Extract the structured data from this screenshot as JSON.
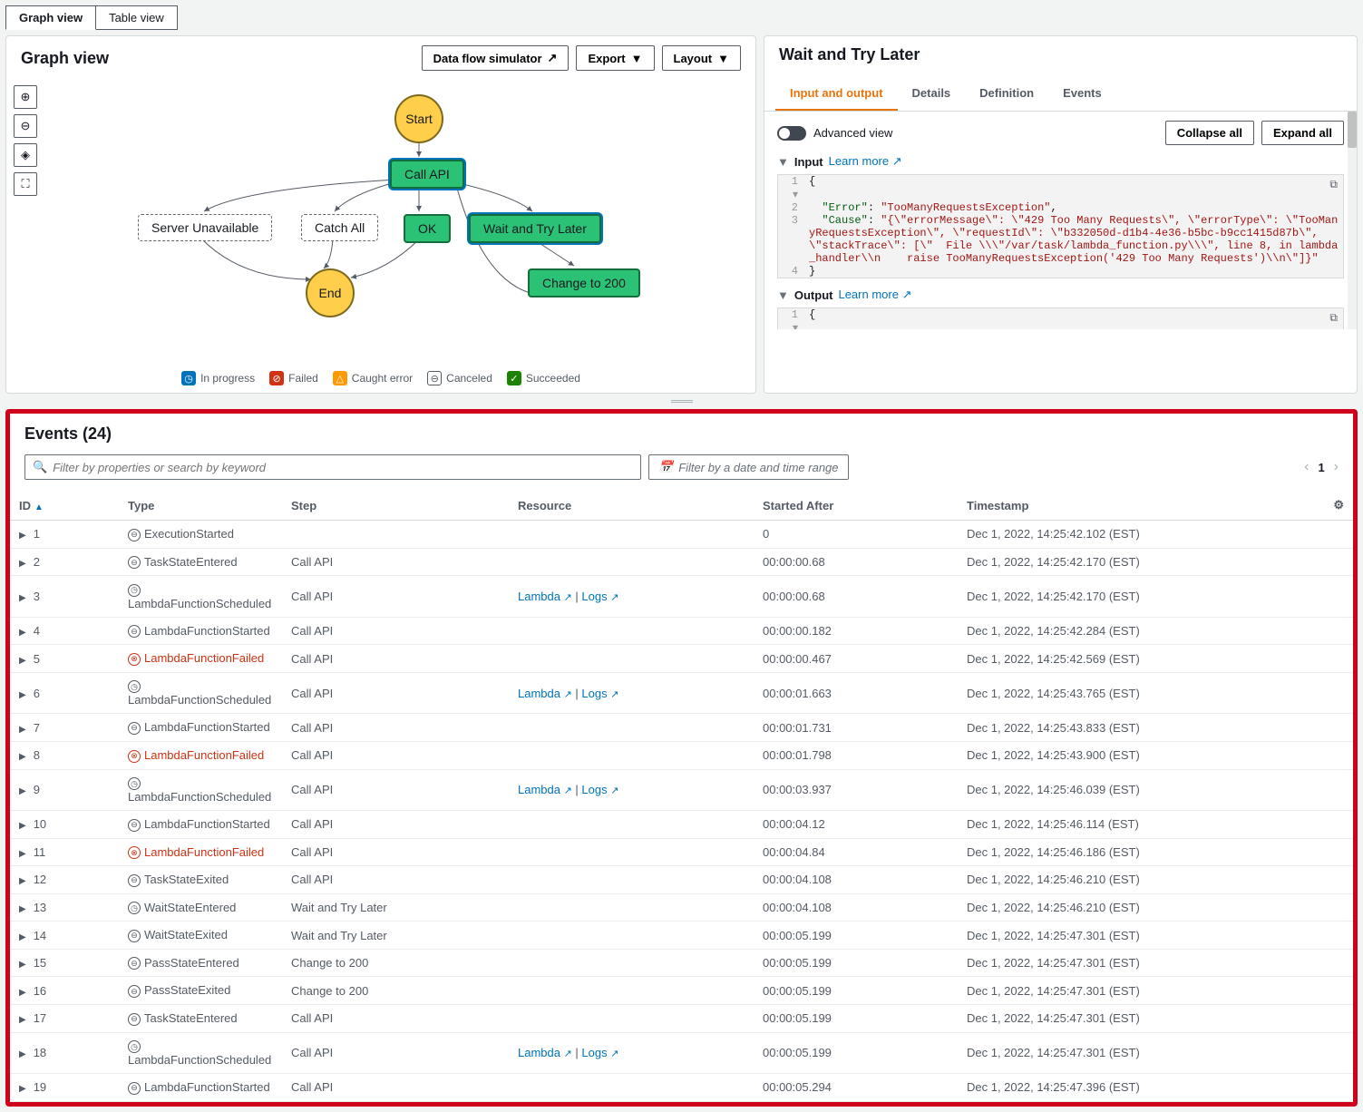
{
  "viewTabs": {
    "graph": "Graph view",
    "table": "Table view"
  },
  "graphPanel": {
    "title": "Graph view",
    "buttons": {
      "simulator": "Data flow simulator",
      "export": "Export",
      "layout": "Layout"
    },
    "nodes": {
      "start": "Start",
      "callApi": "Call API",
      "serverUnavailable": "Server Unavailable",
      "catchAll": "Catch All",
      "ok": "OK",
      "waitTry": "Wait and Try Later",
      "changeTo200": "Change to 200",
      "end": "End"
    },
    "legend": {
      "inProgress": "In progress",
      "failed": "Failed",
      "caughtError": "Caught error",
      "canceled": "Canceled",
      "succeeded": "Succeeded"
    }
  },
  "detailPanel": {
    "title": "Wait and Try Later",
    "tabs": {
      "io": "Input and output",
      "details": "Details",
      "definition": "Definition",
      "events": "Events"
    },
    "advancedView": "Advanced view",
    "collapseAll": "Collapse all",
    "expandAll": "Expand all",
    "inputLabel": "Input",
    "outputLabel": "Output",
    "learnMore": "Learn more",
    "inputJson": {
      "line1": "{",
      "line2_key": "\"Error\"",
      "line2_val": "\"TooManyRequestsException\"",
      "line3_key": "\"Cause\"",
      "line3_val": "\"{\\\"errorMessage\\\": \\\"429 Too Many Requests\\\", \\\"errorType\\\": \\\"TooManyRequestsException\\\", \\\"requestId\\\": \\\"b332050d-d1b4-4e36-b5bc-b9cc1415d87b\\\", \\\"stackTrace\\\": [\\\"  File \\\\\\\"/var/task/lambda_function.py\\\\\\\", line 8, in lambda_handler\\\\n    raise TooManyRequestsException('429 Too Many Requests')\\\\n\\\"]}\"",
      "line4": "}"
    },
    "outputJson": {
      "line1": "{"
    }
  },
  "eventsPanel": {
    "title": "Events (24)",
    "searchPlaceholder": "Filter by properties or search by keyword",
    "datePlaceholder": "Filter by a date and time range",
    "page": "1",
    "columns": {
      "id": "ID",
      "type": "Type",
      "step": "Step",
      "resource": "Resource",
      "startedAfter": "Started After",
      "timestamp": "Timestamp"
    },
    "resourceLambda": "Lambda",
    "resourceLogs": "Logs",
    "rows": [
      {
        "id": "1",
        "icon": "neutral",
        "type": "ExecutionStarted",
        "step": "",
        "resource": "",
        "startedAfter": "0",
        "timestamp": "Dec 1, 2022, 14:25:42.102 (EST)"
      },
      {
        "id": "2",
        "icon": "neutral",
        "type": "TaskStateEntered",
        "step": "Call API",
        "resource": "",
        "startedAfter": "00:00:00.68",
        "timestamp": "Dec 1, 2022, 14:25:42.170 (EST)"
      },
      {
        "id": "3",
        "icon": "clock",
        "type": "LambdaFunctionScheduled",
        "step": "Call API",
        "resource": "links",
        "startedAfter": "00:00:00.68",
        "timestamp": "Dec 1, 2022, 14:25:42.170 (EST)"
      },
      {
        "id": "4",
        "icon": "neutral",
        "type": "LambdaFunctionStarted",
        "step": "Call API",
        "resource": "",
        "startedAfter": "00:00:00.182",
        "timestamp": "Dec 1, 2022, 14:25:42.284 (EST)"
      },
      {
        "id": "5",
        "icon": "fail",
        "type": "LambdaFunctionFailed",
        "step": "Call API",
        "resource": "",
        "startedAfter": "00:00:00.467",
        "timestamp": "Dec 1, 2022, 14:25:42.569 (EST)"
      },
      {
        "id": "6",
        "icon": "clock",
        "type": "LambdaFunctionScheduled",
        "step": "Call API",
        "resource": "links",
        "startedAfter": "00:00:01.663",
        "timestamp": "Dec 1, 2022, 14:25:43.765 (EST)"
      },
      {
        "id": "7",
        "icon": "neutral",
        "type": "LambdaFunctionStarted",
        "step": "Call API",
        "resource": "",
        "startedAfter": "00:00:01.731",
        "timestamp": "Dec 1, 2022, 14:25:43.833 (EST)"
      },
      {
        "id": "8",
        "icon": "fail",
        "type": "LambdaFunctionFailed",
        "step": "Call API",
        "resource": "",
        "startedAfter": "00:00:01.798",
        "timestamp": "Dec 1, 2022, 14:25:43.900 (EST)"
      },
      {
        "id": "9",
        "icon": "clock",
        "type": "LambdaFunctionScheduled",
        "step": "Call API",
        "resource": "links",
        "startedAfter": "00:00:03.937",
        "timestamp": "Dec 1, 2022, 14:25:46.039 (EST)"
      },
      {
        "id": "10",
        "icon": "neutral",
        "type": "LambdaFunctionStarted",
        "step": "Call API",
        "resource": "",
        "startedAfter": "00:00:04.12",
        "timestamp": "Dec 1, 2022, 14:25:46.114 (EST)"
      },
      {
        "id": "11",
        "icon": "fail",
        "type": "LambdaFunctionFailed",
        "step": "Call API",
        "resource": "",
        "startedAfter": "00:00:04.84",
        "timestamp": "Dec 1, 2022, 14:25:46.186 (EST)"
      },
      {
        "id": "12",
        "icon": "neutral",
        "type": "TaskStateExited",
        "step": "Call API",
        "resource": "",
        "startedAfter": "00:00:04.108",
        "timestamp": "Dec 1, 2022, 14:25:46.210 (EST)"
      },
      {
        "id": "13",
        "icon": "clock",
        "type": "WaitStateEntered",
        "step": "Wait and Try Later",
        "resource": "",
        "startedAfter": "00:00:04.108",
        "timestamp": "Dec 1, 2022, 14:25:46.210 (EST)"
      },
      {
        "id": "14",
        "icon": "neutral",
        "type": "WaitStateExited",
        "step": "Wait and Try Later",
        "resource": "",
        "startedAfter": "00:00:05.199",
        "timestamp": "Dec 1, 2022, 14:25:47.301 (EST)"
      },
      {
        "id": "15",
        "icon": "neutral",
        "type": "PassStateEntered",
        "step": "Change to 200",
        "resource": "",
        "startedAfter": "00:00:05.199",
        "timestamp": "Dec 1, 2022, 14:25:47.301 (EST)"
      },
      {
        "id": "16",
        "icon": "neutral",
        "type": "PassStateExited",
        "step": "Change to 200",
        "resource": "",
        "startedAfter": "00:00:05.199",
        "timestamp": "Dec 1, 2022, 14:25:47.301 (EST)"
      },
      {
        "id": "17",
        "icon": "neutral",
        "type": "TaskStateEntered",
        "step": "Call API",
        "resource": "",
        "startedAfter": "00:00:05.199",
        "timestamp": "Dec 1, 2022, 14:25:47.301 (EST)"
      },
      {
        "id": "18",
        "icon": "clock",
        "type": "LambdaFunctionScheduled",
        "step": "Call API",
        "resource": "links",
        "startedAfter": "00:00:05.199",
        "timestamp": "Dec 1, 2022, 14:25:47.301 (EST)"
      },
      {
        "id": "19",
        "icon": "neutral",
        "type": "LambdaFunctionStarted",
        "step": "Call API",
        "resource": "",
        "startedAfter": "00:00:05.294",
        "timestamp": "Dec 1, 2022, 14:25:47.396 (EST)"
      }
    ]
  }
}
